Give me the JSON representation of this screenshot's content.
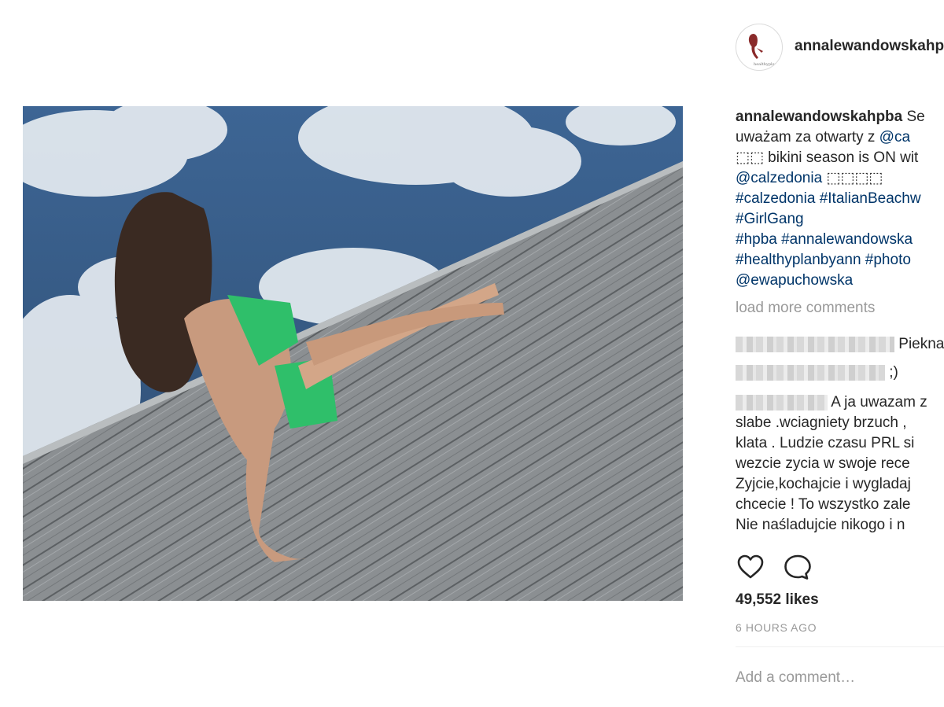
{
  "post": {
    "username": "annalewandowskahpba",
    "caption_lines": [
      {
        "user": "annalewandowskahpba",
        "text": " Se"
      },
      {
        "text": "uważam za otwarty z ",
        "link": "@ca"
      },
      {
        "text": "⬚⬚ bikini season is ON wit"
      },
      {
        "link": "@calzedonia",
        "text": " ⬚⬚⬚⬚"
      },
      {
        "link": "#calzedonia #ItalianBeachw"
      },
      {
        "link": "#GirlGang"
      },
      {
        "link": "#hpba #annalewandowska"
      },
      {
        "link": "#healthyplanbyann #photo"
      },
      {
        "link": "@ewapuchowska"
      }
    ],
    "load_more": "load more comments",
    "comments": [
      {
        "text": " Piekna"
      },
      {
        "text": " ;)"
      },
      {
        "lines": [
          " A ja uwazam z",
          "slabe .wciagniety brzuch ,",
          "klata . Ludzie czasu PRL si",
          "wezcie zycia w swoje rece",
          "Zyjcie,kochajcie i wygladaj",
          "chcecie ! To wszystko zale",
          "Nie naśladujcie nikogo i n"
        ]
      }
    ],
    "likes": "49,552 likes",
    "time": "6 HOURS AGO",
    "add_comment_placeholder": "Add a comment…",
    "icons": {
      "like": "heart-icon",
      "comment": "comment-bubble-icon"
    }
  }
}
